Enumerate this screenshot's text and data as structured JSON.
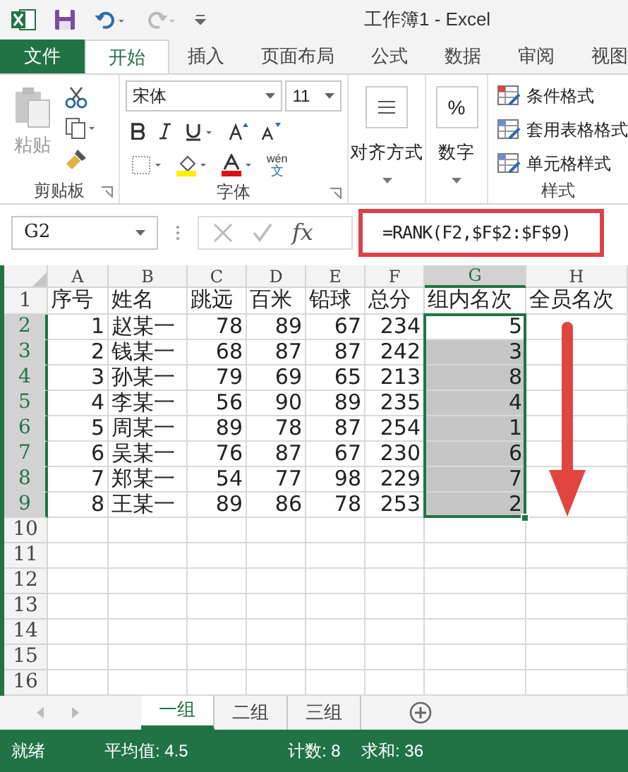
{
  "title_bar": {
    "title": "工作簿1 - Excel"
  },
  "ribbon": {
    "tabs": [
      {
        "label": "文件",
        "kind": "file",
        "selected": false
      },
      {
        "label": "开始",
        "kind": "tab",
        "selected": true
      },
      {
        "label": "插入",
        "kind": "tab",
        "selected": false
      },
      {
        "label": "页面布局",
        "kind": "tab",
        "selected": false
      },
      {
        "label": "公式",
        "kind": "tab",
        "selected": false
      },
      {
        "label": "数据",
        "kind": "tab",
        "selected": false
      },
      {
        "label": "审阅",
        "kind": "tab",
        "selected": false
      },
      {
        "label": "视图",
        "kind": "tab",
        "selected": false
      }
    ],
    "clipboard": {
      "paste": "粘贴",
      "label": "剪贴板"
    },
    "font": {
      "name": "宋体",
      "size": "11",
      "phonetic": "wén",
      "phonetic_char": "文",
      "label": "字体"
    },
    "alignment": {
      "label": "对齐方式"
    },
    "number": {
      "symbol": "%",
      "label": "数字"
    },
    "styles": {
      "items": [
        "条件格式",
        "套用表格格式",
        "单元格样式"
      ],
      "label": "样式"
    }
  },
  "formula_bar": {
    "name_box": "G2",
    "function_button": "fx",
    "formula": "=RANK(F2,$F$2:$F$9)",
    "highlighted": true
  },
  "sheet": {
    "columns": [
      {
        "label": "A",
        "kind": "number",
        "selected": false
      },
      {
        "label": "B",
        "kind": "text",
        "selected": false
      },
      {
        "label": "C",
        "kind": "number",
        "selected": false
      },
      {
        "label": "D",
        "kind": "number",
        "selected": false
      },
      {
        "label": "E",
        "kind": "number",
        "selected": false
      },
      {
        "label": "F",
        "kind": "number",
        "selected": false
      },
      {
        "label": "G",
        "kind": "number",
        "selected": true
      },
      {
        "label": "H",
        "kind": "number",
        "selected": false
      }
    ],
    "rows": [
      {
        "number": "1",
        "kind": "header",
        "selected": false,
        "active": false,
        "cells": [
          "序号",
          "姓名",
          "跳远",
          "百米",
          "铅球",
          "总分",
          "组内名次",
          "全员名次"
        ]
      },
      {
        "number": "2",
        "kind": "data",
        "selected": true,
        "active": true,
        "cells": [
          "1",
          "赵某一",
          "78",
          "89",
          "67",
          "234",
          "5"
        ]
      },
      {
        "number": "3",
        "kind": "data",
        "selected": true,
        "active": false,
        "cells": [
          "2",
          "钱某一",
          "68",
          "87",
          "87",
          "242",
          "3"
        ]
      },
      {
        "number": "4",
        "kind": "data",
        "selected": true,
        "active": false,
        "cells": [
          "3",
          "孙某一",
          "79",
          "69",
          "65",
          "213",
          "8"
        ]
      },
      {
        "number": "5",
        "kind": "data",
        "selected": true,
        "active": false,
        "cells": [
          "4",
          "李某一",
          "56",
          "90",
          "89",
          "235",
          "4"
        ]
      },
      {
        "number": "6",
        "kind": "data",
        "selected": true,
        "active": false,
        "cells": [
          "5",
          "周某一",
          "89",
          "78",
          "87",
          "254",
          "1"
        ]
      },
      {
        "number": "7",
        "kind": "data",
        "selected": true,
        "active": false,
        "cells": [
          "6",
          "吴某一",
          "76",
          "87",
          "67",
          "230",
          "6"
        ]
      },
      {
        "number": "8",
        "kind": "data",
        "selected": true,
        "active": false,
        "cells": [
          "7",
          "郑某一",
          "54",
          "77",
          "98",
          "229",
          "7"
        ]
      },
      {
        "number": "9",
        "kind": "data",
        "selected": true,
        "active": false,
        "cells": [
          "8",
          "王某一",
          "89",
          "86",
          "78",
          "253",
          "2"
        ]
      },
      {
        "number": "10",
        "kind": "data",
        "selected": false,
        "active": false
      },
      {
        "number": "11",
        "kind": "data",
        "selected": false,
        "active": false
      },
      {
        "number": "12",
        "kind": "data",
        "selected": false,
        "active": false
      },
      {
        "number": "13",
        "kind": "data",
        "selected": false,
        "active": false
      },
      {
        "number": "14",
        "kind": "data",
        "selected": false,
        "active": false
      },
      {
        "number": "15",
        "kind": "data",
        "selected": false,
        "active": false
      },
      {
        "number": "16",
        "kind": "data",
        "selected": false,
        "active": false
      }
    ],
    "down_arrow": true
  },
  "sheet_tabs": [
    {
      "label": "一组",
      "selected": true
    },
    {
      "label": "二组",
      "selected": false
    },
    {
      "label": "三组",
      "selected": false
    }
  ],
  "status_bar": {
    "ready": "就绪",
    "average": "平均值: 4.5",
    "count": "计数: 8",
    "sum": "求和: 36"
  }
}
